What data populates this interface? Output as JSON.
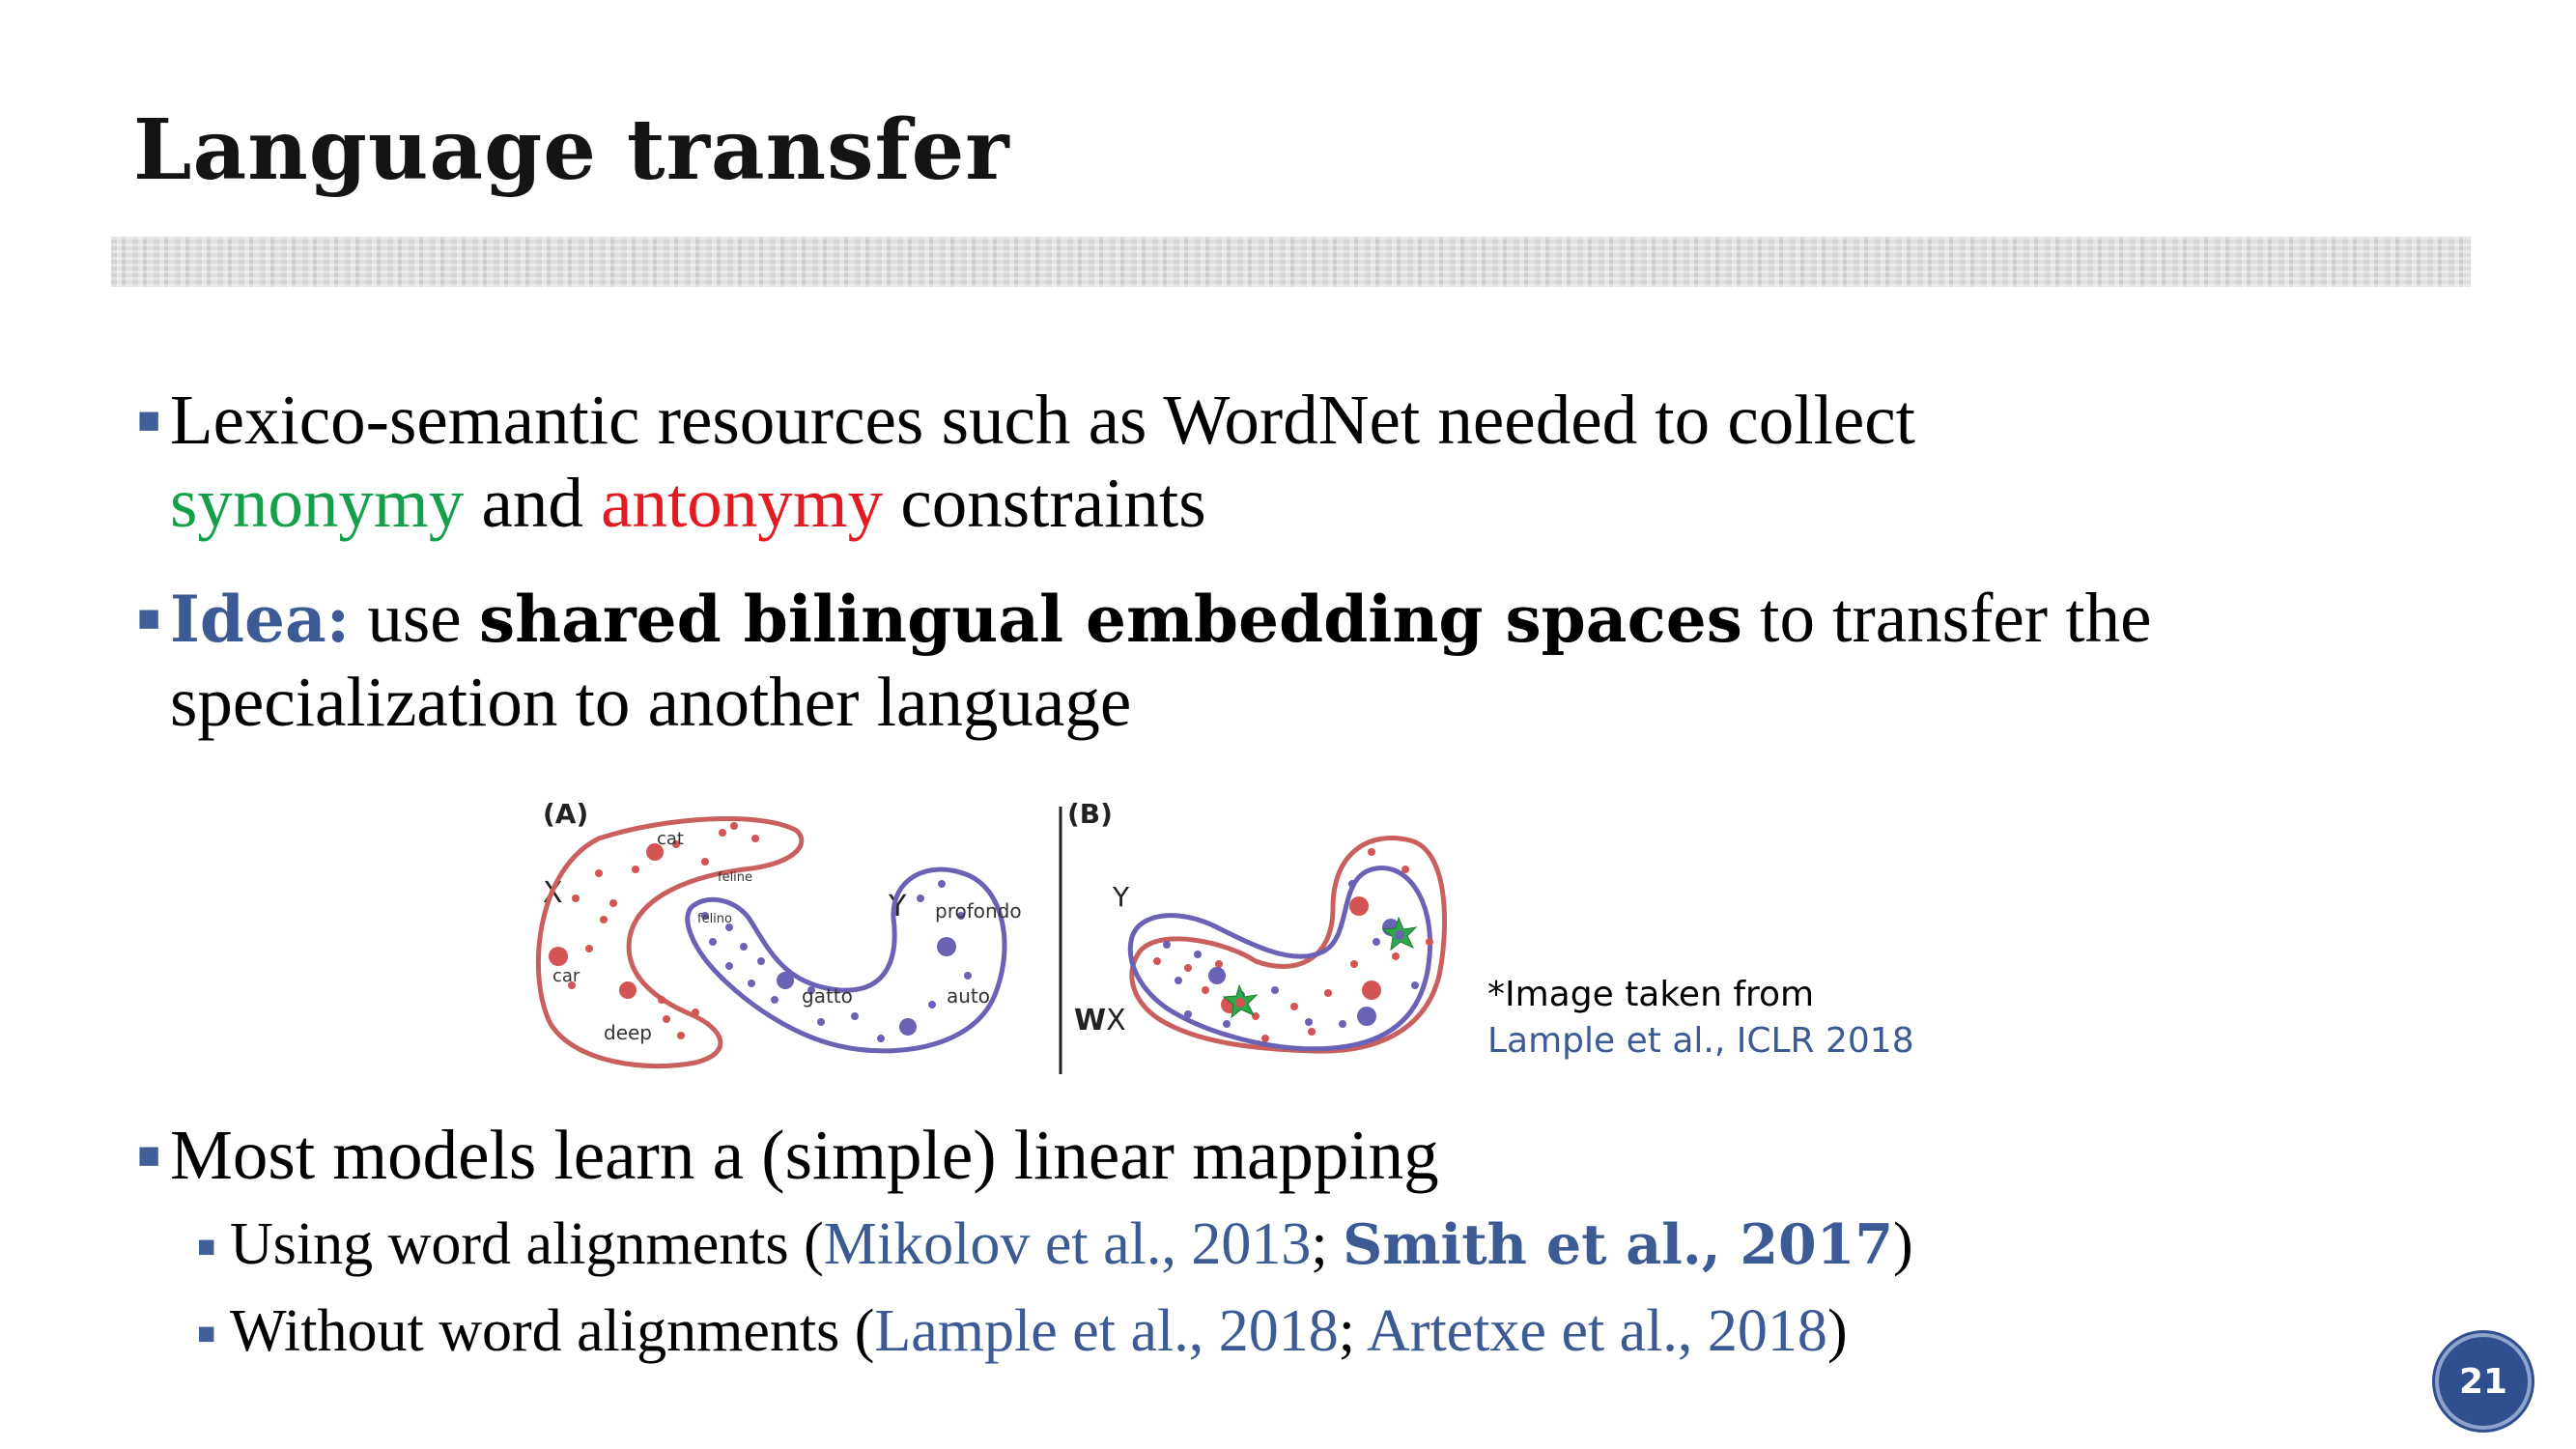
{
  "slide": {
    "title": "Language transfer",
    "page_number": "21"
  },
  "bullets": {
    "b1": {
      "text_a": "Lexico-semantic resources such as WordNet needed to collect",
      "synonymy": "synonymy",
      "and": " and ",
      "antonymy": "antonymy",
      "text_b": " constraints"
    },
    "b2": {
      "idea": "Idea:",
      "text_a": " use ",
      "bold": "shared bilingual embedding spaces",
      "text_b": " to transfer the specialization to another language"
    },
    "b3": {
      "text": "Most models learn a (simple) linear mapping"
    },
    "s1": {
      "text_a": "Using word alignments (",
      "ref1": "Mikolov et al., 2013",
      "sep": "; ",
      "ref2": "Smith et al., 2017",
      "close": ")"
    },
    "s2": {
      "text_a": "Without word alignments (",
      "ref1": "Lample et al., 2018",
      "sep": "; ",
      "ref2": "Artetxe et al., 2018",
      "close": ")"
    }
  },
  "figure": {
    "panel_a": "(A)",
    "panel_b": "(B)",
    "label_x": "X",
    "label_y": "Y",
    "label_wx": "WX",
    "label_w": "W",
    "label_x2": "X",
    "label_y2": "Y",
    "words": {
      "cat": "cat",
      "feline": "feline",
      "car": "car",
      "deep": "deep",
      "felino": "felino",
      "gatto": "gatto",
      "profondo": "profondo",
      "auto": "auto"
    }
  },
  "caption": {
    "line1": "*Image taken from",
    "line2": "Lample et al., ICLR 2018"
  },
  "colors": {
    "accent_blue": "#3c5a94",
    "synonymy_green": "#14a04b",
    "antonymy_red": "#e11b22",
    "region_red": "#c9605e",
    "region_blue": "#6a62b4"
  }
}
